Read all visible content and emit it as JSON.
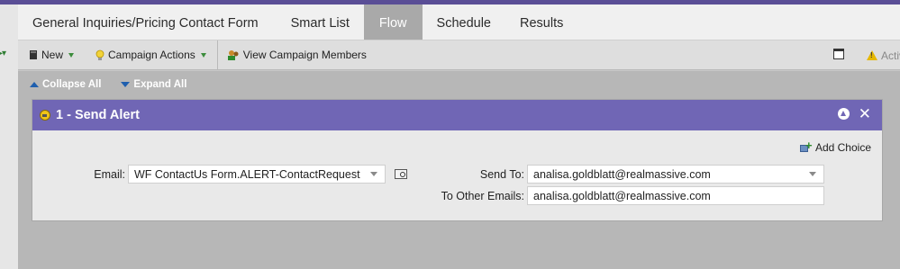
{
  "tabs": [
    {
      "label": "General Inquiries/Pricing Contact Form",
      "active": false
    },
    {
      "label": "Smart List",
      "active": false
    },
    {
      "label": "Flow",
      "active": true
    },
    {
      "label": "Schedule",
      "active": false
    },
    {
      "label": "Results",
      "active": false
    }
  ],
  "toolbar": {
    "new_label": "New",
    "campaign_actions_label": "Campaign Actions",
    "view_members_label": "View Campaign Members",
    "active_label": "Activ"
  },
  "flow": {
    "collapse_all": "Collapse All",
    "expand_all": "Expand All",
    "step": {
      "title": "1 - Send Alert",
      "add_choice": "Add Choice",
      "email_label": "Email:",
      "email_value": "WF ContactUs Form.ALERT-ContactRequest",
      "send_to_label": "Send To:",
      "send_to_value": "analisa.goldblatt@realmassive.com",
      "other_emails_label": "To Other Emails:",
      "other_emails_value": "analisa.goldblatt@realmassive.com"
    }
  },
  "colors": {
    "brand_purple": "#5a4e96",
    "step_header": "#7066b5",
    "active_tab": "#a9a9a9",
    "accent_green": "#3b8c3b",
    "link_blue": "#1f5fae"
  }
}
